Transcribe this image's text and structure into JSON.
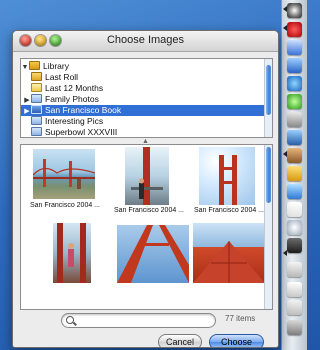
{
  "window": {
    "title": "Choose Images"
  },
  "source_list": {
    "items": [
      {
        "label": "Library",
        "icon": "library-icon",
        "expander": "open"
      },
      {
        "label": "Last Roll",
        "icon": "last-roll-icon",
        "expander": ""
      },
      {
        "label": "Last 12 Months",
        "icon": "last-12-months-icon",
        "expander": ""
      },
      {
        "label": "Family Photos",
        "icon": "album-icon",
        "expander": "closed"
      },
      {
        "label": "San Francisco Book",
        "icon": "book-icon",
        "expander": "closed",
        "selected": true
      },
      {
        "label": "Interesting Pics",
        "icon": "album-icon",
        "expander": ""
      },
      {
        "label": "Superbowl XXXVIII",
        "icon": "album-icon",
        "expander": ""
      }
    ]
  },
  "photos": {
    "items": [
      {
        "caption": "San Francisco 2004 ..."
      },
      {
        "caption": "San Francisco 2004 ..."
      },
      {
        "caption": "San Francisco 2004 ..."
      },
      {
        "caption": ""
      },
      {
        "caption": ""
      },
      {
        "caption": ""
      }
    ]
  },
  "search": {
    "placeholder": "",
    "value": ""
  },
  "status": {
    "count": "77 items"
  },
  "buttons": {
    "cancel": "Cancel",
    "choose": "Choose"
  },
  "colors": {
    "selection": "#2f6fd6",
    "desktop": "#2f6dc0"
  }
}
